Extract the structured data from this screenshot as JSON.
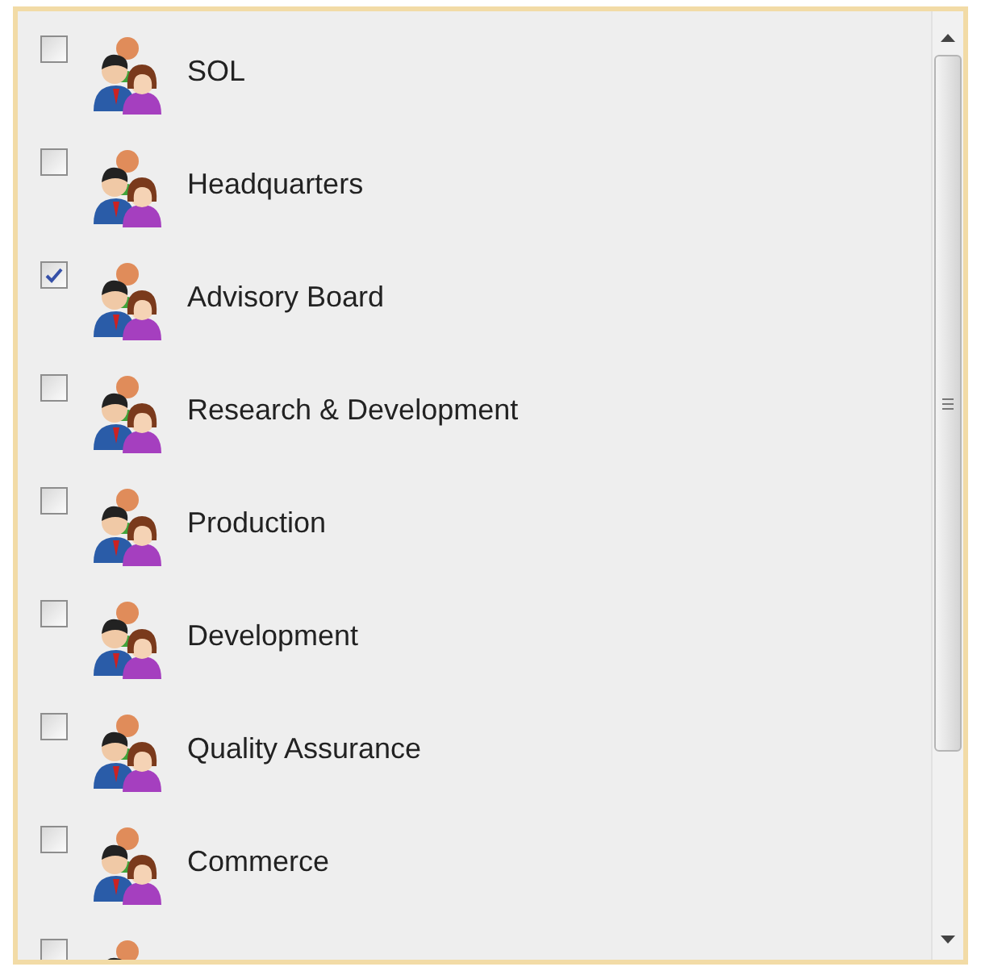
{
  "items": [
    {
      "label": "SOL",
      "checked": false
    },
    {
      "label": "Headquarters",
      "checked": false
    },
    {
      "label": "Advisory Board",
      "checked": true
    },
    {
      "label": "Research & Development",
      "checked": false
    },
    {
      "label": "Production",
      "checked": false
    },
    {
      "label": "Development",
      "checked": false
    },
    {
      "label": "Quality Assurance",
      "checked": false
    },
    {
      "label": "Commerce",
      "checked": false
    },
    {
      "checked": false
    }
  ]
}
